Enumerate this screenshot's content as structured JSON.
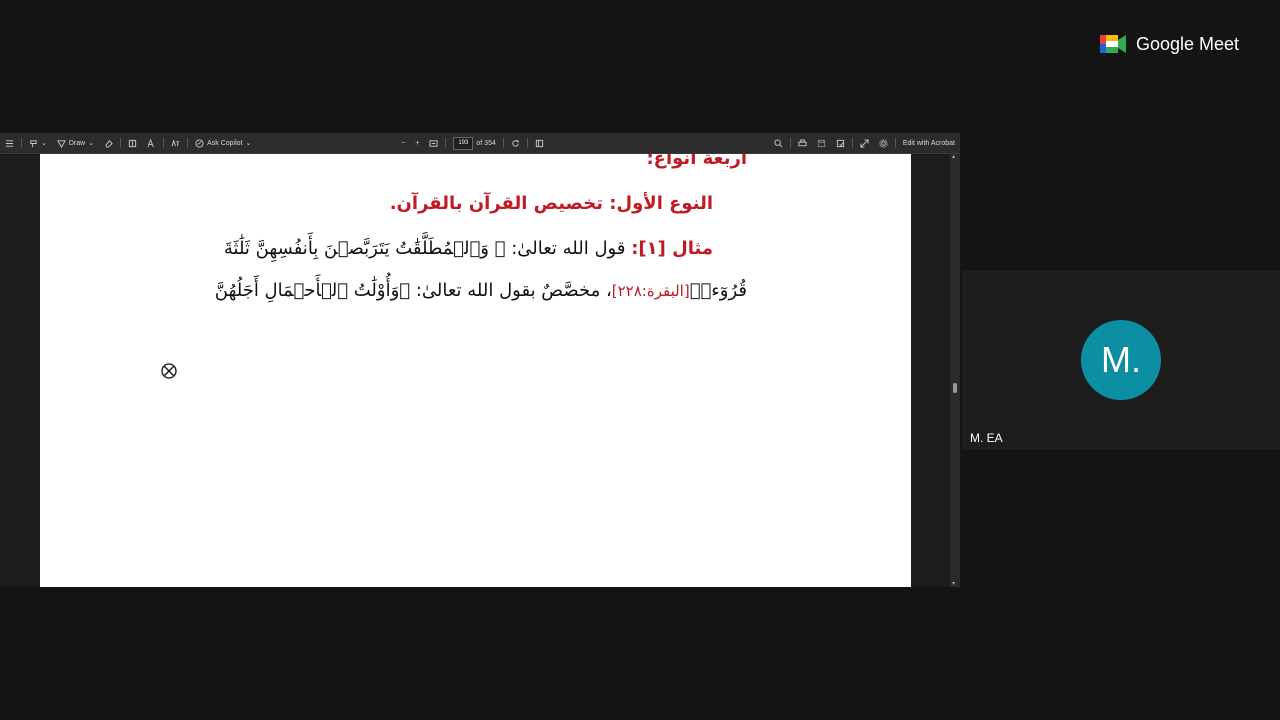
{
  "toolbar": {
    "draw_label": "Draw",
    "copilot_label": "Ask Copilot",
    "page_current": "193",
    "page_total": "of 354",
    "edit_label": "Edit with Acrobat"
  },
  "document": {
    "line_top": "أربعة أنواع:",
    "heading": "النوع الأول: تخصيص القرآن بالقرآن.",
    "example_label": "مثال [١]:",
    "example_text": "قول الله تعالىٰ: ﴿ وَٱلۡمُطَلَّقَٰتُ يَتَرَبَّصۡنَ بِأَنفُسِهِنَّ ثَلَٰثَةَ",
    "verse_end": "قُرُوٓءٖ﴾",
    "reference": "[البقرة:٢٢٨]",
    "second_line_text": "، مخصَّصٌ بقول الله تعالىٰ: ﴿وَأُوْلَٰتُ ٱلۡأَحۡمَالِ أَجَلُهُنَّ"
  },
  "meet": {
    "brand": "Google Meet",
    "participant_initial": "M.",
    "participant_name": "M. EA",
    "avatar_color": "#0d8fa3"
  }
}
